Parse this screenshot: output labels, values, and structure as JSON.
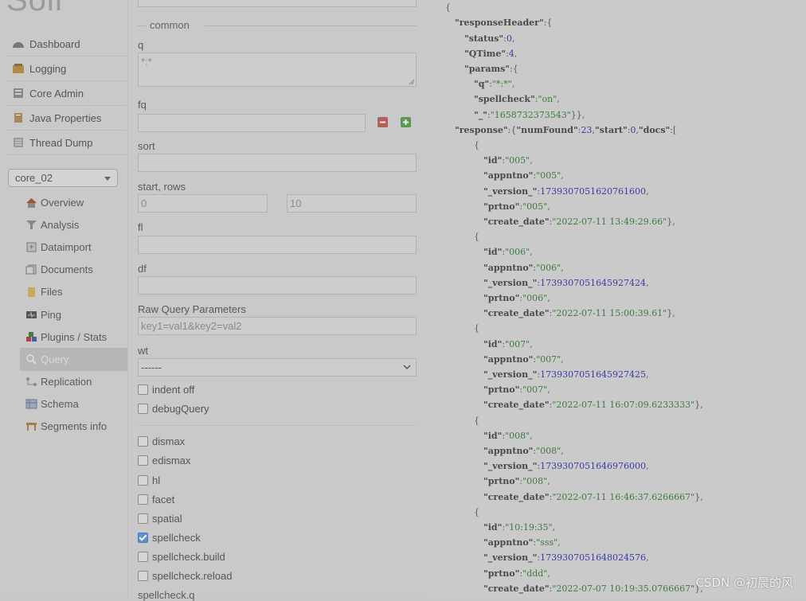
{
  "brand": "Solr",
  "nav": [
    {
      "label": "Dashboard",
      "icon": "dashboard-icon"
    },
    {
      "label": "Logging",
      "icon": "logging-icon"
    },
    {
      "label": "Core Admin",
      "icon": "core-admin-icon"
    },
    {
      "label": "Java Properties",
      "icon": "java-properties-icon"
    },
    {
      "label": "Thread Dump",
      "icon": "thread-dump-icon"
    }
  ],
  "core_selector": {
    "value": "core_02"
  },
  "core_menu": [
    {
      "label": "Overview",
      "icon": "overview-icon"
    },
    {
      "label": "Analysis",
      "icon": "analysis-icon"
    },
    {
      "label": "Dataimport",
      "icon": "dataimport-icon"
    },
    {
      "label": "Documents",
      "icon": "documents-icon"
    },
    {
      "label": "Files",
      "icon": "files-icon"
    },
    {
      "label": "Ping",
      "icon": "ping-icon"
    },
    {
      "label": "Plugins / Stats",
      "icon": "plugins-icon"
    },
    {
      "label": "Query",
      "icon": "query-icon",
      "active": true
    },
    {
      "label": "Replication",
      "icon": "replication-icon"
    },
    {
      "label": "Schema",
      "icon": "schema-icon"
    },
    {
      "label": "Segments info",
      "icon": "segments-icon"
    }
  ],
  "form": {
    "section_legend": "common",
    "q_label": "q",
    "q_value": "*:*",
    "fq_label": "fq",
    "sort_label": "sort",
    "start_rows_label": "start, rows",
    "start_placeholder": "0",
    "rows_placeholder": "10",
    "fl_label": "fl",
    "df_label": "df",
    "raw_label": "Raw Query Parameters",
    "raw_placeholder": "key1=val1&key2=val2",
    "wt_label": "wt",
    "wt_value": "------",
    "indent_off": "indent off",
    "debug_query": "debugQuery",
    "options": [
      {
        "label": "dismax",
        "checked": false
      },
      {
        "label": "edismax",
        "checked": false
      },
      {
        "label": "hl",
        "checked": false
      },
      {
        "label": "facet",
        "checked": false
      },
      {
        "label": "spatial",
        "checked": false
      },
      {
        "label": "spellcheck",
        "checked": true
      },
      {
        "label": "spellcheck.build",
        "checked": false
      },
      {
        "label": "spellcheck.reload",
        "checked": false
      }
    ],
    "spellcheck_q_label": "spellcheck.q"
  },
  "response": {
    "header": {
      "status": "0",
      "QTime": "4",
      "q": "\"*:*\"",
      "spellcheck": "\"on\"",
      "_": "\"1658732373543\""
    },
    "numFound": "23",
    "start": "0",
    "docs": [
      {
        "id": "\"005\"",
        "appntno": "\"005\"",
        "version": "1739307051620761600",
        "prtno": "\"005\"",
        "create_date": "\"2022-07-11 13:49:29.66\""
      },
      {
        "id": "\"006\"",
        "appntno": "\"006\"",
        "version": "1739307051645927424",
        "prtno": "\"006\"",
        "create_date": "\"2022-07-11 15:00:39.61\""
      },
      {
        "id": "\"007\"",
        "appntno": "\"007\"",
        "version": "1739307051645927425",
        "prtno": "\"007\"",
        "create_date": "\"2022-07-11 16:07:09.6233333\""
      },
      {
        "id": "\"008\"",
        "appntno": "\"008\"",
        "version": "1739307051646976000",
        "prtno": "\"008\"",
        "create_date": "\"2022-07-11 16:46:37.6266667\""
      },
      {
        "id": "\"10:19:35\"",
        "appntno": "\"sss\"",
        "version": "1739307051648024576",
        "prtno": "\"ddd\"",
        "create_date": "\"2022-07-07 10:19:35.0766667\""
      }
    ]
  },
  "watermark": "CSDN @初晨的风"
}
